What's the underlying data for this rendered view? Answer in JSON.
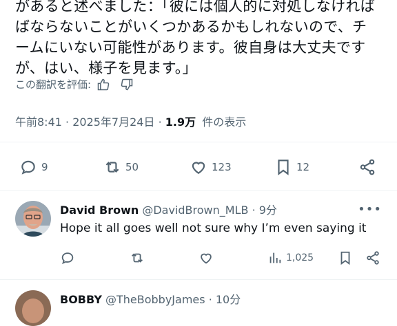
{
  "tweet": {
    "lines": [
      "があると述べました：「彼には個人的に対処しなければ",
      "ばならないことがいくつかあるかもしれないので、チ",
      "ームにいない可能性があります。彼自身は大丈夫です",
      "が、はい、様子を見ます。」"
    ],
    "translate_label": "この翻訳を評価:",
    "time": "午前8:41",
    "date": "2025年7月24日",
    "views_count": "1.9万",
    "views_label": "件の表示"
  },
  "actions": {
    "replies": "9",
    "reposts": "50",
    "likes": "123",
    "bookmarks": "12"
  },
  "replies": [
    {
      "name": "David Brown",
      "handle": "@DavidBrown_MLB",
      "time": "9分",
      "text": "Hope it all goes well not sure why I’m even saying it",
      "views": "1,025"
    },
    {
      "name": "BOBBY",
      "handle": "@TheBobbyJames",
      "time": "10分"
    }
  ],
  "colors": {
    "text": "#0f1419",
    "secondary": "#536471",
    "divider": "#eff3f4"
  }
}
